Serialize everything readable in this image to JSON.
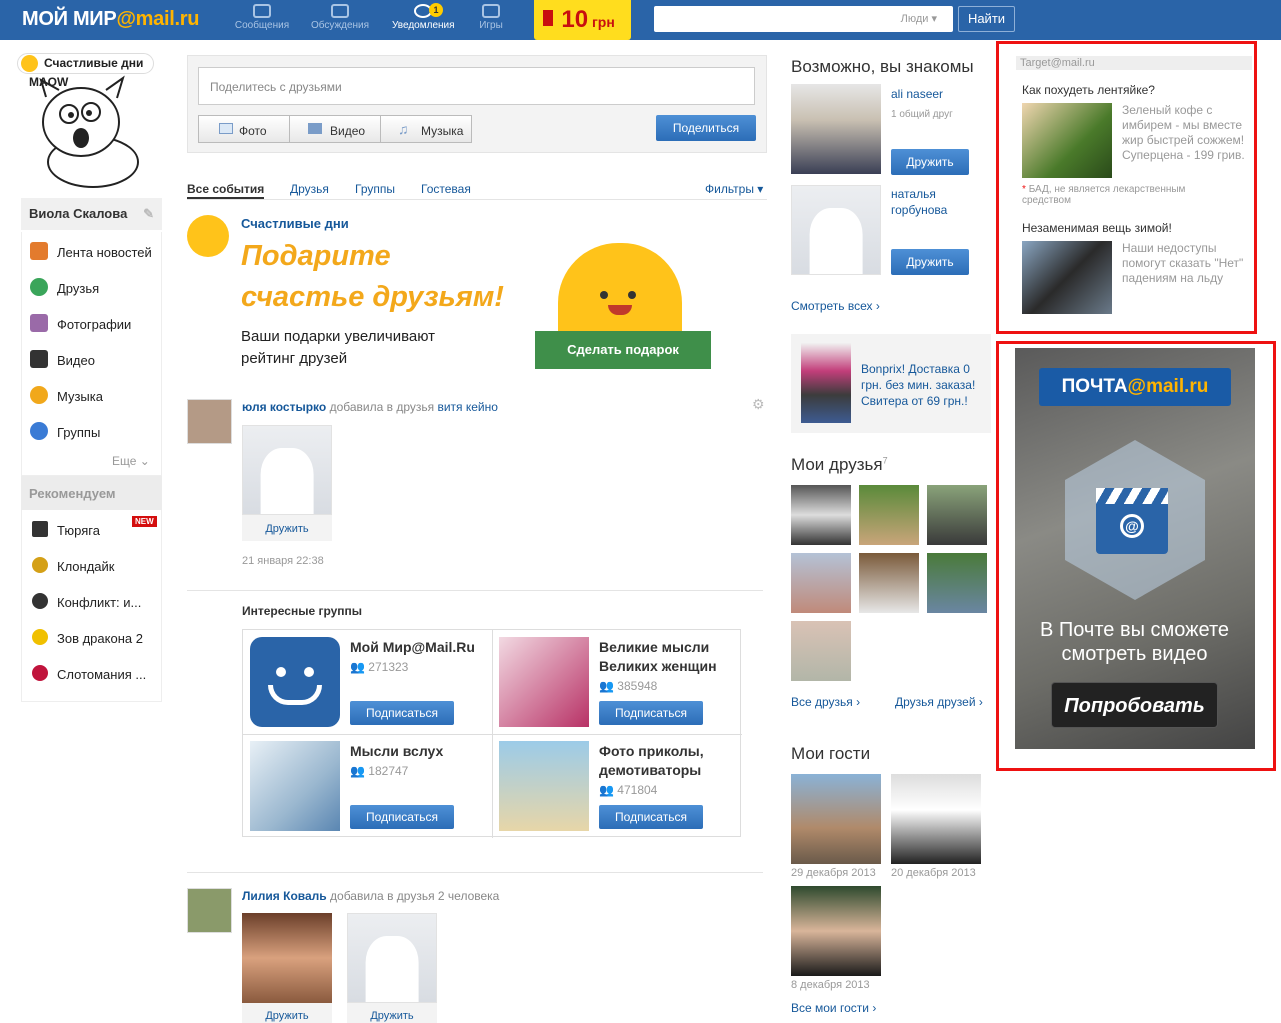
{
  "header": {
    "logo_text": "МОЙ МИР",
    "logo_at": "@mail.ru",
    "nav": [
      {
        "label": "Сообщения",
        "icon": "chat-icon"
      },
      {
        "label": "Обсуждения",
        "icon": "discussions-icon"
      },
      {
        "label": "Уведомления",
        "icon": "bell-icon"
      },
      {
        "label": "Игры",
        "icon": "gamepad-icon"
      }
    ],
    "notifications_count": "1",
    "promo_value": "10",
    "promo_unit": "грн",
    "search_scope": "Люди",
    "search_button": "Найти"
  },
  "profile": {
    "happy_tag": "Счастливые дни",
    "name": "Виола Скалова"
  },
  "menu": [
    {
      "label": "Лента новостей",
      "icon": "home-icon",
      "color": "#e37b2d"
    },
    {
      "label": "Друзья",
      "icon": "friends-icon",
      "color": "#3aa55a"
    },
    {
      "label": "Фотографии",
      "icon": "camera-icon",
      "color": "#9a6aa8"
    },
    {
      "label": "Видео",
      "icon": "clapperboard-icon",
      "color": "#333333"
    },
    {
      "label": "Музыка",
      "icon": "music-note-icon",
      "color": "#f1a81b"
    },
    {
      "label": "Группы",
      "icon": "groups-icon",
      "color": "#3a7bd5"
    }
  ],
  "menu_more": "Еще",
  "recommend": {
    "title": "Рекомендуем",
    "items": [
      {
        "label": "Тюряга",
        "icon": "hash-icon",
        "color": "#333333",
        "badge": "NEW"
      },
      {
        "label": "Клондайк",
        "icon": "klondike-icon",
        "color": "#d4a017"
      },
      {
        "label": "Конфликт: и...",
        "icon": "conflict-icon",
        "color": "#333333"
      },
      {
        "label": "Зов дракона 2",
        "icon": "dragon-icon",
        "color": "#f0c000"
      },
      {
        "label": "Слотомания ...",
        "icon": "star-icon",
        "color": "#c0143c"
      }
    ]
  },
  "share": {
    "placeholder": "Поделитесь с друзьями",
    "photo": "Фото",
    "video": "Видео",
    "music": "Музыка",
    "submit": "Поделиться"
  },
  "tabs": [
    "Все события",
    "Друзья",
    "Группы",
    "Гостевая"
  ],
  "filters": "Фильтры",
  "happy_days": {
    "title": "Счастливые дни",
    "heading": "Подарите счастье друзьям!",
    "text": "Ваши подарки увеличивают рейтинг друзей",
    "button": "Сделать подарок"
  },
  "feed1": {
    "author": "юля костырко",
    "action": "добавила в друзья",
    "target": "витя кейно",
    "add_friend": "Дружить",
    "time": "21 января 22:38"
  },
  "interesting_groups": {
    "title": "Интересные группы",
    "subscribe": "Подписаться",
    "groups": [
      {
        "name": "Мой Мир@Mail.Ru",
        "count": "271323"
      },
      {
        "name": "Великие мысли Великих женщин",
        "count": "385948"
      },
      {
        "name": "Мысли вслух",
        "count": "182747"
      },
      {
        "name": "Фото приколы, демотиваторы",
        "count": "471804"
      }
    ]
  },
  "feed2": {
    "author": "Лилия Коваль",
    "action": "добавила в друзья 2 человека",
    "add_friend": "Дружить"
  },
  "pymk": {
    "title": "Возможно, вы знакомы",
    "people": [
      {
        "name": "ali naseer",
        "mutual": "1 общий друг"
      },
      {
        "name": "наталья горбунова",
        "mutual": ""
      }
    ],
    "add_friend": "Дружить",
    "see_all": "Смотреть всех"
  },
  "bonprix": {
    "text": "Bonprix! Доставка 0 грн. без мин. заказа! Свитера от 69 грн.!"
  },
  "my_friends": {
    "title": "Мои друзья",
    "count": "7",
    "all_friends": "Все друзья",
    "friends_of_friends": "Друзья друзей"
  },
  "guests": {
    "title": "Мои гости",
    "dates": [
      "29 декабря 2013",
      "20 декабря 2013",
      "8 декабря 2013"
    ],
    "all_guests": "Все мои гости"
  },
  "target_ads": {
    "header": "Target@mail.ru",
    "ads": [
      {
        "title": "Как похудеть лентяйке?",
        "text": "Зеленый кофе с имбирем - мы вместе жир быстрей сожжем! Суперцена - 199 грив.",
        "note": "БАД, не является лекарственным средством"
      },
      {
        "title": "Незаменимая вещь зимой!",
        "text": "Наши недоступы помогут сказать \"Нет\" падениям на льду"
      }
    ]
  },
  "mail_ad": {
    "logo": "ПОЧТА",
    "logo_at": "@mail.ru",
    "text": "В Почте вы сможете смотреть видео",
    "button": "Попробовать"
  }
}
